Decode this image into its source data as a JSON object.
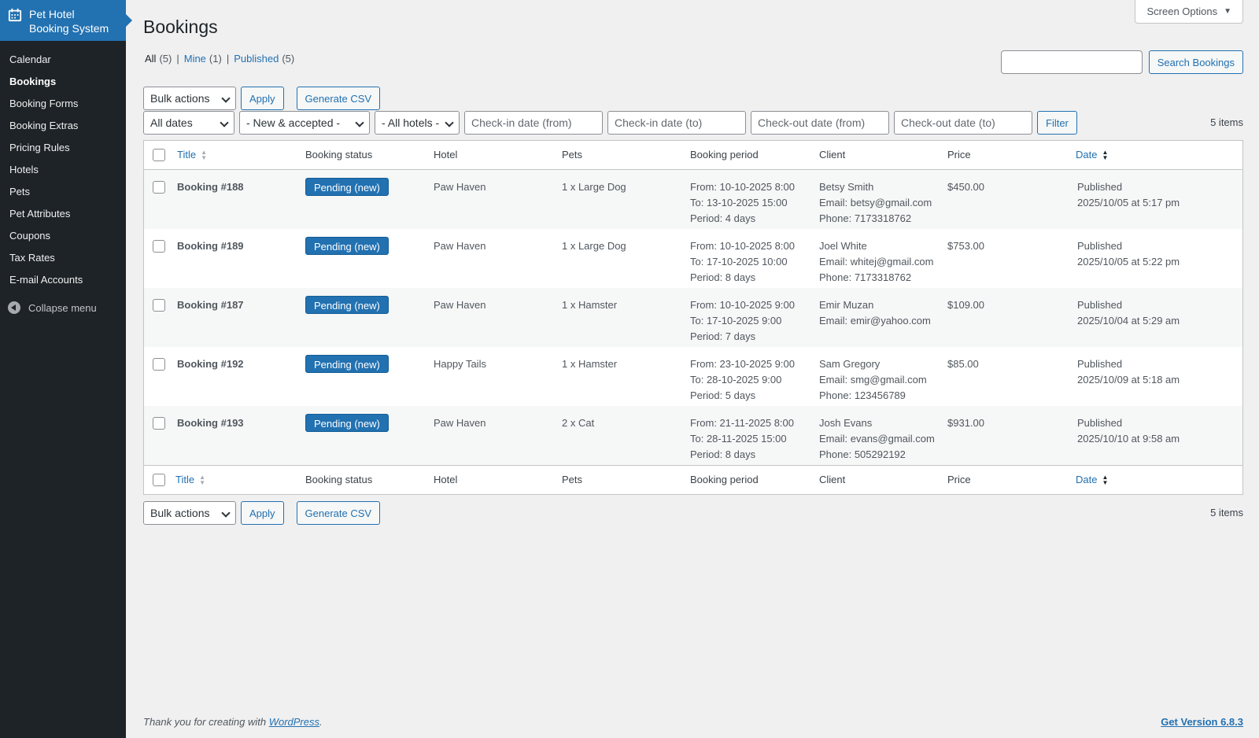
{
  "sidebar": {
    "brand_line1": "Pet Hotel",
    "brand_line2": "Booking System",
    "brand_icon": "calendar-icon",
    "items": [
      {
        "label": "Calendar"
      },
      {
        "label": "Bookings"
      },
      {
        "label": "Booking Forms"
      },
      {
        "label": "Booking Extras"
      },
      {
        "label": "Pricing Rules"
      },
      {
        "label": "Hotels"
      },
      {
        "label": "Pets"
      },
      {
        "label": "Pet Attributes"
      },
      {
        "label": "Coupons"
      },
      {
        "label": "Tax Rates"
      },
      {
        "label": "E-mail Accounts"
      }
    ],
    "collapse_label": "Collapse menu"
  },
  "header": {
    "title": "Bookings",
    "screen_options": "Screen Options"
  },
  "views": {
    "all": "All",
    "all_count": "(5)",
    "mine": "Mine",
    "mine_count": "(1)",
    "published": "Published",
    "published_count": "(5)",
    "sep": "|"
  },
  "search": {
    "button": "Search Bookings"
  },
  "actions": {
    "bulk": "Bulk actions",
    "apply": "Apply",
    "csv": "Generate CSV",
    "filter": "Filter",
    "items": "5 items"
  },
  "filters": {
    "dates": "All dates",
    "status": "- New & accepted -",
    "hotels": "- All hotels -",
    "checkin_from": "Check-in date (from)",
    "checkin_to": "Check-in date (to)",
    "checkout_from": "Check-out date (from)",
    "checkout_to": "Check-out date (to)"
  },
  "table": {
    "columns": {
      "title": "Title",
      "status": "Booking status",
      "hotel": "Hotel",
      "pets": "Pets",
      "period": "Booking period",
      "client": "Client",
      "price": "Price",
      "date": "Date"
    },
    "rows": [
      {
        "title": "Booking #188",
        "status": "Pending (new)",
        "hotel": "Paw Haven",
        "pets": "1 x Large Dog",
        "period1": "From: 10-10-2025 8:00",
        "period2": "To: 13-10-2025 15:00",
        "period3": "Period: 4 days",
        "client1": "Betsy Smith",
        "client2": "Email: betsy@gmail.com",
        "client3": "Phone: 7173318762",
        "price": "$450.00",
        "date1": "Published",
        "date2": "2025/10/05 at 5:17 pm"
      },
      {
        "title": "Booking #189",
        "status": "Pending (new)",
        "hotel": "Paw Haven",
        "pets": "1 x Large Dog",
        "period1": "From: 10-10-2025 8:00",
        "period2": "To: 17-10-2025 10:00",
        "period3": "Period: 8 days",
        "client1": "Joel White",
        "client2": "Email: whitej@gmail.com",
        "client3": "Phone: 7173318762",
        "price": "$753.00",
        "date1": "Published",
        "date2": "2025/10/05 at 5:22 pm"
      },
      {
        "title": "Booking #187",
        "status": "Pending (new)",
        "hotel": "Paw Haven",
        "pets": "1 x Hamster",
        "period1": "From: 10-10-2025 9:00",
        "period2": "To: 17-10-2025 9:00",
        "period3": "Period: 7 days",
        "client1": "Emir Muzan",
        "client2": "Email: emir@yahoo.com",
        "client3": "",
        "price": "$109.00",
        "date1": "Published",
        "date2": "2025/10/04 at 5:29 am"
      },
      {
        "title": "Booking #192",
        "status": "Pending (new)",
        "hotel": "Happy Tails",
        "pets": "1 x Hamster",
        "period1": "From: 23-10-2025 9:00",
        "period2": "To: 28-10-2025 9:00",
        "period3": "Period: 5 days",
        "client1": "Sam Gregory",
        "client2": "Email: smg@gmail.com",
        "client3": "Phone: 123456789",
        "price": "$85.00",
        "date1": "Published",
        "date2": "2025/10/09 at 5:18 am"
      },
      {
        "title": "Booking #193",
        "status": "Pending (new)",
        "hotel": "Paw Haven",
        "pets": "2 x Cat",
        "period1": "From: 21-11-2025 8:00",
        "period2": "To: 28-11-2025 15:00",
        "period3": "Period: 8 days",
        "client1": "Josh Evans",
        "client2": "Email: evans@gmail.com",
        "client3": "Phone: 505292192",
        "price": "$931.00",
        "date1": "Published",
        "date2": "2025/10/10 at 9:58 am"
      }
    ]
  },
  "footer": {
    "thanks_prefix": "Thank you for creating with",
    "wp": "WordPress",
    "thanks_suffix": ".",
    "version": "Get Version 6.8.3"
  },
  "colors": {
    "accent": "#2271b1",
    "sidebar": "#1d2327"
  }
}
